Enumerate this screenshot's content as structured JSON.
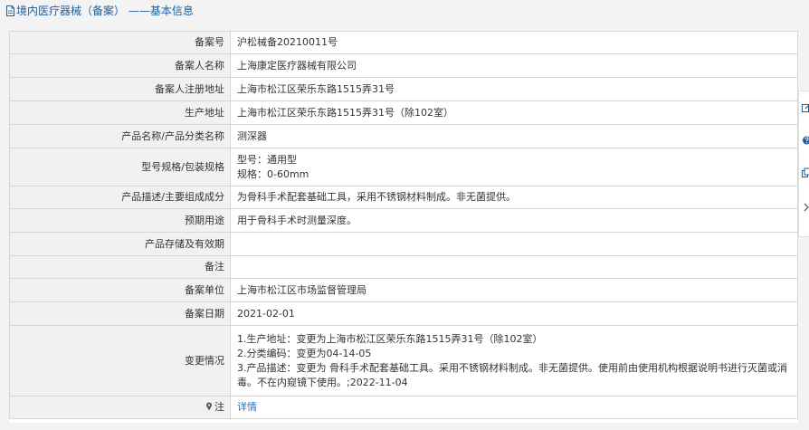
{
  "header": {
    "title": "境内医疗器械（备案） ——基本信息"
  },
  "rows": [
    {
      "label": "备案号",
      "value": "沪松械备20210011号"
    },
    {
      "label": "备案人名称",
      "value": "上海康定医疗器械有限公司"
    },
    {
      "label": "备案人注册地址",
      "value": "上海市松江区荣乐东路1515弄31号"
    },
    {
      "label": "生产地址",
      "value": "上海市松江区荣乐东路1515弄31号（除102室）"
    },
    {
      "label": "产品名称/产品分类名称",
      "value": "测深器"
    },
    {
      "label": "型号规格/包装规格",
      "lines": [
        "型号：通用型",
        "规格：0-60mm"
      ]
    },
    {
      "label": "产品描述/主要组成成分",
      "value": "为骨科手术配套基础工具，采用不锈钢材料制成。非无菌提供。"
    },
    {
      "label": "预期用途",
      "value": "用于骨科手术时测量深度。"
    },
    {
      "label": "产品存储及有效期",
      "value": ""
    },
    {
      "label": "备注",
      "value": ""
    },
    {
      "label": "备案单位",
      "value": "上海市松江区市场监督管理局"
    },
    {
      "label": "备案日期",
      "value": "2021-02-01"
    },
    {
      "label": "变更情况",
      "lines": [
        "1.生产地址：变更为上海市松江区荣乐东路1515弄31号（除102室）",
        "2.分类编码：变更为04-14-05",
        "3.产品描述：变更为 骨科手术配套基础工具。采用不锈钢材料制成。非无菌提供。使用前由使用机构根据说明书进行灭菌或消毒。不在内窥镜下使用。;2022-11-04"
      ]
    },
    {
      "label": "注",
      "value": "详情"
    }
  ],
  "colors": {
    "title": "#1f5f9a",
    "link": "#2a6fb5",
    "label_bg": "#f1f1f1",
    "border": "#d6d6d6"
  },
  "icons": {
    "title": "document-icon",
    "note": "pin-icon",
    "side": [
      "edit-icon",
      "help-icon",
      "copy-icon",
      "chevron-right-icon"
    ]
  }
}
